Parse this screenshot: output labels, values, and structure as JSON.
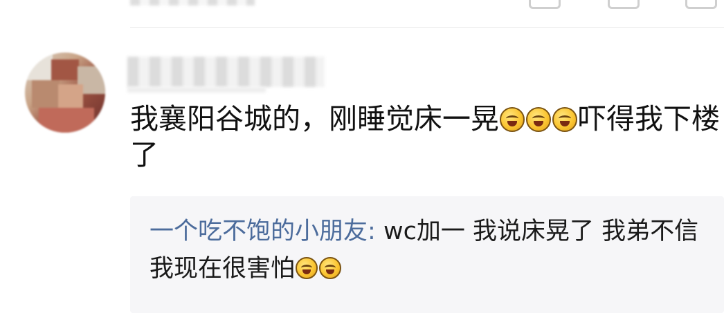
{
  "comment": {
    "text_part1": "我襄阳谷城的，刚睡觉床一晃",
    "emojis_inline": [
      "laugh-cry-icon",
      "laugh-cry-icon",
      "laugh-cry-icon"
    ],
    "text_part2": "吓得我下楼了"
  },
  "reply": {
    "username": "一个吃不饱的小朋友",
    "separator": ":",
    "text": "wc加一 我说床晃了 我弟不信 我现在很害怕",
    "emojis_inline": [
      "laugh-cry-icon",
      "laugh-cry-icon"
    ]
  }
}
